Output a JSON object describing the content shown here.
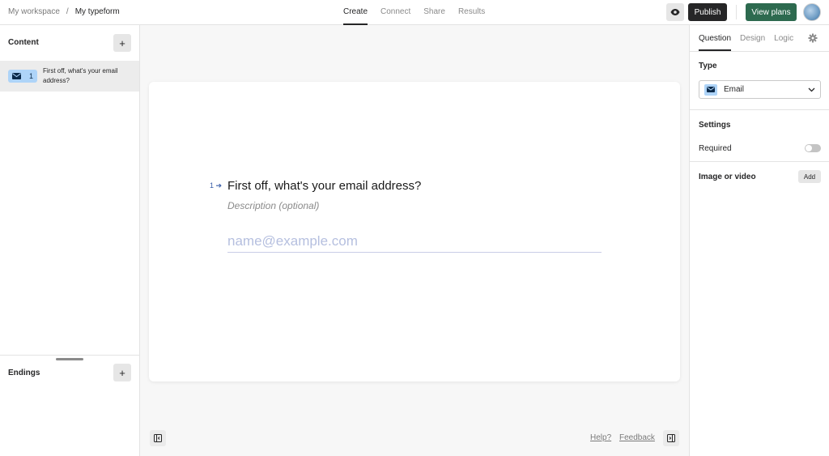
{
  "header": {
    "breadcrumb": {
      "workspace": "My workspace",
      "separator": "/",
      "form": "My typeform"
    },
    "tabs": [
      {
        "label": "Create"
      },
      {
        "label": "Connect"
      },
      {
        "label": "Share"
      },
      {
        "label": "Results"
      }
    ],
    "publish_label": "Publish",
    "view_plans_label": "View plans",
    "icons": {
      "preview": "eye-icon"
    }
  },
  "sidebar": {
    "content_title": "Content",
    "add_symbol": "+",
    "items": [
      {
        "number": "1",
        "text": "First off, what's your email address?",
        "icon": "envelope-icon"
      }
    ],
    "endings_title": "Endings"
  },
  "canvas": {
    "question": {
      "number": "1",
      "title": "First off, what's your email address?",
      "description_placeholder": "Description (optional)",
      "input_placeholder": "name@example.com"
    },
    "footer": {
      "help": "Help?",
      "feedback": "Feedback"
    }
  },
  "panel": {
    "tabs": [
      {
        "label": "Question"
      },
      {
        "label": "Design"
      },
      {
        "label": "Logic"
      }
    ],
    "type_label": "Type",
    "type_value": "Email",
    "settings_label": "Settings",
    "required_label": "Required",
    "required_on": false,
    "media_label": "Image or video",
    "add_label": "Add"
  },
  "colors": {
    "accent_blue": "#aed4f8",
    "view_plans_green": "#2d6a4f",
    "publish_dark": "#262627",
    "question_number": "#3a5ea8"
  }
}
